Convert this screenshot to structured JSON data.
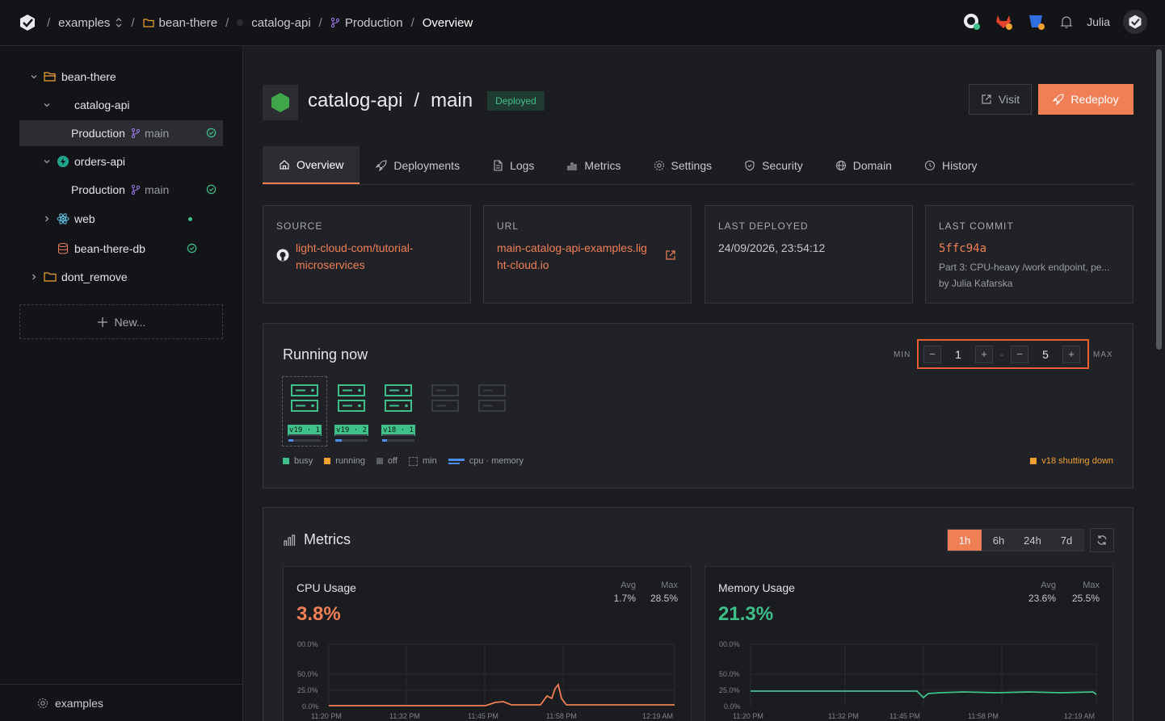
{
  "breadcrumb": {
    "org": "examples",
    "project": "bean-there",
    "service": "catalog-api",
    "environment": "Production",
    "page": "Overview"
  },
  "user": {
    "name": "Julia"
  },
  "sidebar": {
    "project": "bean-there",
    "services": [
      {
        "name": "catalog-api",
        "env": "Production",
        "branch": "main"
      },
      {
        "name": "orders-api",
        "env": "Production",
        "branch": "main"
      },
      {
        "name": "web"
      },
      {
        "name": "bean-there-db"
      }
    ],
    "other_project": "dont_remove",
    "new_label": "New...",
    "footer_label": "examples"
  },
  "header": {
    "service": "catalog-api",
    "slash": "/",
    "branch": "main",
    "badge": "Deployed",
    "visit_label": "Visit",
    "redeploy_label": "Redeploy"
  },
  "tabs": [
    "Overview",
    "Deployments",
    "Logs",
    "Metrics",
    "Settings",
    "Security",
    "Domain",
    "History"
  ],
  "cards": {
    "source": {
      "label": "SOURCE",
      "line1": "light-cloud-com/tutorial-",
      "line2": "microservices"
    },
    "url": {
      "label": "URL",
      "line1": "main-catalog-api-examples.lig",
      "line2": "ht-cloud.io"
    },
    "last_deployed": {
      "label": "LAST DEPLOYED",
      "value": "24/09/2026, 23:54:12"
    },
    "last_commit": {
      "label": "LAST COMMIT",
      "sha": "5ffc94a",
      "message": "Part 3: CPU-heavy /work endpoint, pe...",
      "author": "by Julia Kafarska"
    }
  },
  "running": {
    "title": "Running now",
    "min_label": "MIN",
    "max_label": "MAX",
    "min_value": "1",
    "max_value": "5",
    "dash": "-",
    "minus": "−",
    "plus": "+",
    "instances": [
      {
        "label": "v19 · 1",
        "cpu": 0.15
      },
      {
        "label": "v19 · 2",
        "cpu": 0.2
      },
      {
        "label": "v18 · 1",
        "cpu": 0.15
      }
    ],
    "legend": [
      "busy",
      "running",
      "off",
      "min",
      "cpu · memory"
    ],
    "note": "v18 shutting down",
    "colors": {
      "busy": "#3fbf8a",
      "running": "#f0a030",
      "off": "#5a5d63",
      "cpu": "#4b8ef0"
    }
  },
  "metrics": {
    "title": "Metrics",
    "ranges": [
      "1h",
      "6h",
      "24h",
      "7d"
    ],
    "active_range": "1h",
    "cpu": {
      "title": "CPU Usage",
      "current": "3.8%",
      "avg_label": "Avg",
      "avg": "1.7%",
      "max_label": "Max",
      "max": "28.5%",
      "color": "#f07f55"
    },
    "memory": {
      "title": "Memory Usage",
      "current": "21.3%",
      "avg_label": "Avg",
      "avg": "23.6%",
      "max_label": "Max",
      "max": "25.5%",
      "color": "#3fbf8a"
    },
    "y_ticks": [
      "00.0%",
      "50.0%",
      "25.0%",
      "0.0%"
    ],
    "x_ticks": [
      "11:20 PM",
      "11:32 PM",
      "11:45 PM",
      "11:58 PM",
      "12:19 AM"
    ]
  }
}
